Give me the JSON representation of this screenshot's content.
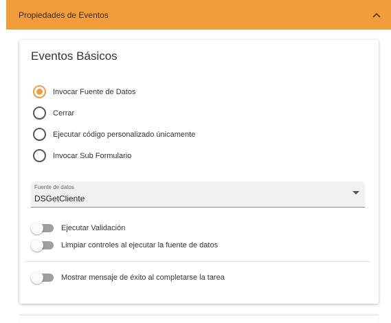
{
  "panel": {
    "title": "Propiedades de Eventos",
    "expanded": true,
    "accent_color": "#f39c3c"
  },
  "card": {
    "title": "Eventos Básicos",
    "radio_options": [
      {
        "label": "Invocar Fuente de Datos",
        "checked": true
      },
      {
        "label": "Cerrar",
        "checked": false
      },
      {
        "label": "Ejecutar código personalizado únicamente",
        "checked": false
      },
      {
        "label": "Invocar Sub Formulario",
        "checked": false
      }
    ],
    "datasource_field": {
      "label": "Fuente de datos",
      "value": "DSGetCliente"
    },
    "toggles": [
      {
        "label": "Ejecutar Validación",
        "on": false
      },
      {
        "label": "Limpiar controles al ejecutar la fuente de datos",
        "on": false
      },
      {
        "label": "Mostrar mensaje de éxito al completarse la tarea",
        "on": false
      }
    ]
  },
  "icons": {
    "collapse": "chevron-up-icon",
    "dropdown": "caret-down-icon"
  }
}
